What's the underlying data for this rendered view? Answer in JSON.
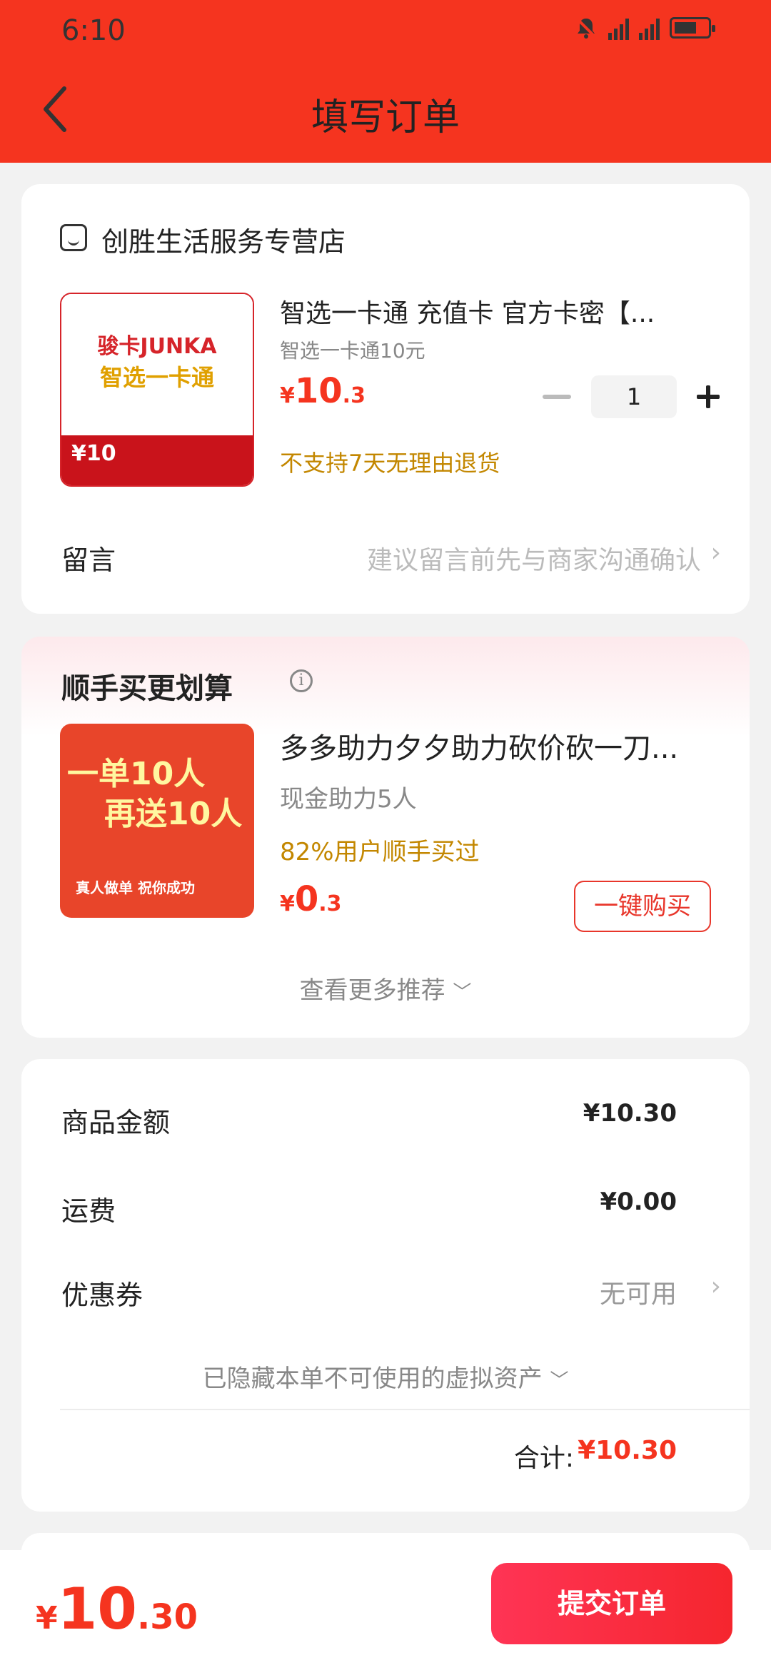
{
  "status_bar": {
    "time": "6:10"
  },
  "nav": {
    "title": "填写订单"
  },
  "store": {
    "name": "创胜生活服务专营店"
  },
  "product": {
    "title": "智选一卡通 充值卡 官方卡密【...",
    "sku": "智选一卡通10元",
    "price_symbol": "¥",
    "price_int": "10",
    "price_dec": ".3",
    "quantity": "1",
    "return_policy": "不支持7天无理由退货",
    "image_texts": {
      "brand": "骏卡JUNKA",
      "name": "智选一卡通",
      "value": "¥10"
    }
  },
  "message": {
    "label": "留言",
    "placeholder": "建议留言前先与商家沟通确认"
  },
  "recommend": {
    "title": "顺手买更划算",
    "item": {
      "name": "多多助力夕夕助力砍价砍一刀...",
      "subtitle": "现金助力5人",
      "bought": "82%用户顺手买过",
      "price_symbol": "¥",
      "price_int": "0",
      "price_dec": ".3",
      "buy_label": "一键购买",
      "image_texts": {
        "line1": "一单10人",
        "line2": "再送10人",
        "line3": "真人做单 祝你成功"
      }
    },
    "more_label": "查看更多推荐"
  },
  "summary": {
    "goods_label": "商品金额",
    "goods_value": "¥10.30",
    "shipping_label": "运费",
    "shipping_value": "¥0.00",
    "coupon_label": "优惠券",
    "coupon_value": "无可用",
    "hidden_assets": "已隐藏本单不可使用的虚拟资产",
    "total_label": "合计:",
    "total_value": "¥10.30"
  },
  "bottom": {
    "price_symbol": "¥",
    "price_int": "10",
    "price_dec": ".30",
    "submit_label": "提交订单"
  },
  "colors": {
    "primary": "#f5341f",
    "warning": "#c38700",
    "button_gradient": "#ff3455"
  }
}
